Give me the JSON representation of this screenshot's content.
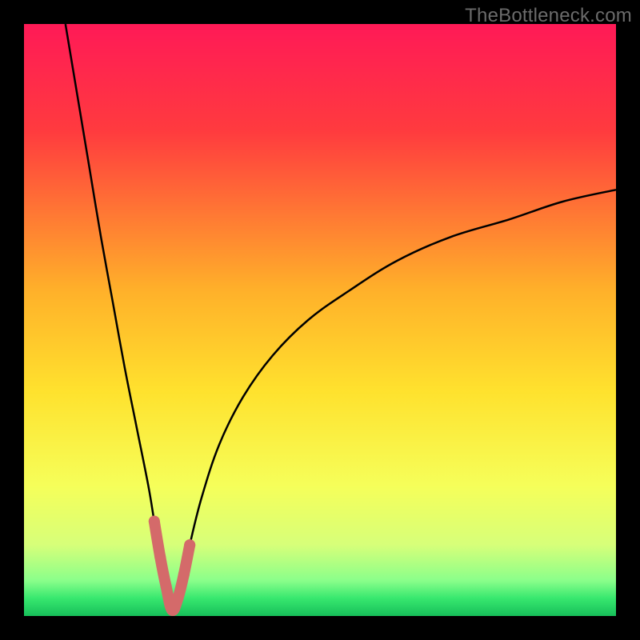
{
  "watermark": "TheBottleneck.com",
  "colors": {
    "frame": "#000000",
    "gradient_stops": [
      {
        "pct": 0,
        "color": "#ff1a57"
      },
      {
        "pct": 18,
        "color": "#ff3b3f"
      },
      {
        "pct": 45,
        "color": "#ffb12a"
      },
      {
        "pct": 62,
        "color": "#ffe22e"
      },
      {
        "pct": 78,
        "color": "#f6ff5a"
      },
      {
        "pct": 88,
        "color": "#d7ff7a"
      },
      {
        "pct": 94,
        "color": "#8bff8b"
      },
      {
        "pct": 97,
        "color": "#38e86f"
      },
      {
        "pct": 100,
        "color": "#17c05a"
      }
    ],
    "curve": "#000000",
    "highlight": "#d46a6a"
  },
  "chart_data": {
    "type": "line",
    "title": "",
    "xlabel": "",
    "ylabel": "",
    "xlim": [
      0,
      100
    ],
    "ylim": [
      0,
      100
    ],
    "curve_note": "V-shaped bottleneck curve; y≈100 at x≈7, minimum y≈1 at x≈25, rises to y≈72 at x=100",
    "series": [
      {
        "name": "bottleneck-curve",
        "x": [
          7,
          9,
          11,
          13,
          15,
          17,
          19,
          21,
          22,
          23,
          24,
          25,
          26,
          27,
          28,
          30,
          33,
          37,
          42,
          48,
          55,
          63,
          72,
          82,
          91,
          100
        ],
        "y": [
          100,
          88,
          76,
          64,
          53,
          42,
          32,
          22,
          16,
          10,
          5,
          1,
          3,
          7,
          12,
          20,
          29,
          37,
          44,
          50,
          55,
          60,
          64,
          67,
          70,
          72
        ]
      },
      {
        "name": "optimal-region-highlight",
        "x": [
          22,
          23,
          24,
          25,
          26,
          27,
          28
        ],
        "y": [
          16,
          10,
          5,
          1,
          3,
          7,
          12
        ]
      }
    ]
  }
}
